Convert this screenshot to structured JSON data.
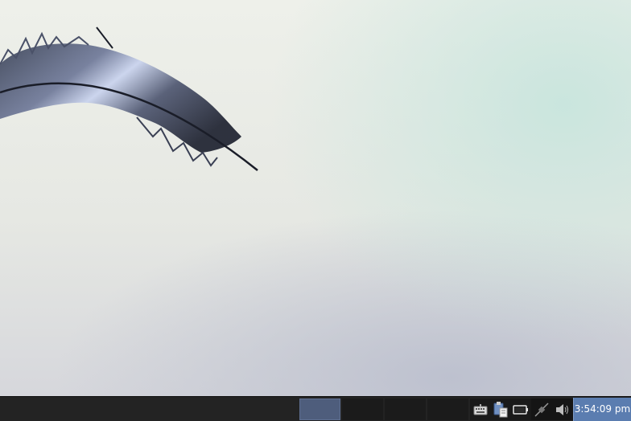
{
  "desktop": {
    "wallpaper_icon": "feather-wallpaper"
  },
  "taskbar": {
    "pager": {
      "desktops": [
        {
          "icon": "desktop-1",
          "active": true
        },
        {
          "icon": "desktop-2",
          "active": false
        },
        {
          "icon": "desktop-3",
          "active": false
        },
        {
          "icon": "desktop-4",
          "active": false
        }
      ]
    },
    "tray": {
      "icons": [
        "keyboard-icon",
        "clipboard-icon",
        "battery-icon",
        "network-icon",
        "volume-icon"
      ]
    },
    "clock": {
      "time": "3:54:09 pm"
    }
  },
  "colors": {
    "taskbar": "#232323",
    "active_desktop": "#4e5d7c",
    "clock_bg": "#5b7db0"
  }
}
